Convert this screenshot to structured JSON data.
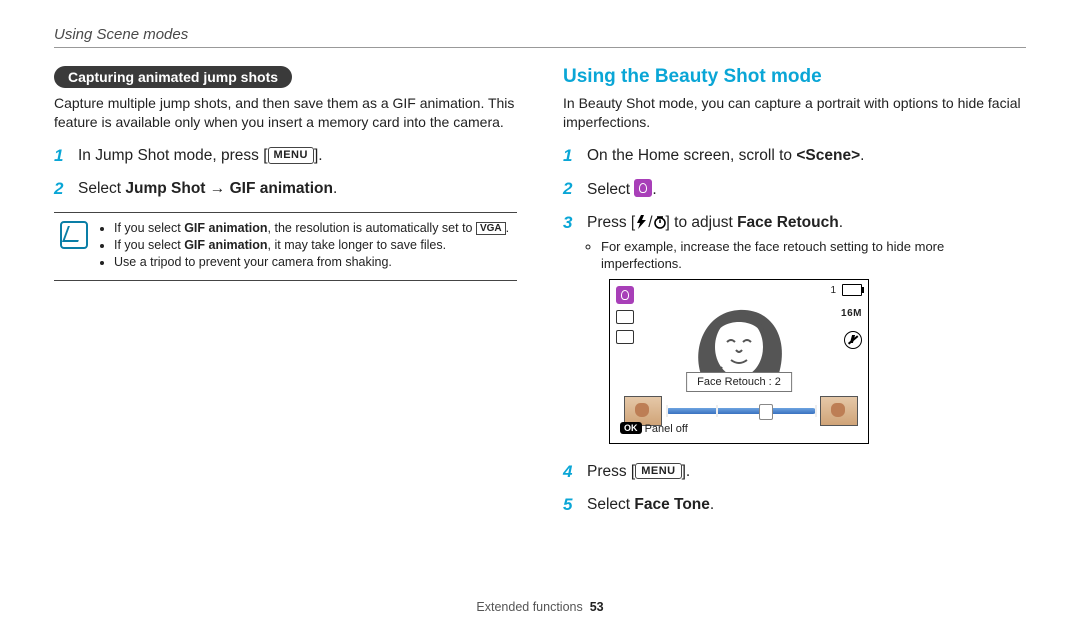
{
  "chapter": "Using Scene modes",
  "left": {
    "pill": "Capturing animated jump shots",
    "intro": "Capture multiple jump shots, and then save them as a GIF animation. This feature is available only when you insert a memory card into the camera.",
    "step1_pre": "In Jump Shot mode, press [",
    "step1_menu": "MENU",
    "step1_post": "].",
    "step2_a": "Select ",
    "step2_b": "Jump Shot",
    "step2_arrow": " → ",
    "step2_c": "GIF animation",
    "step2_d": ".",
    "note1_a": "If you select ",
    "note1_b": "GIF animation",
    "note1_c": ", the resolution is automatically set to ",
    "note1_vga": "VGA",
    "note1_d": ".",
    "note2_a": "If you select ",
    "note2_b": "GIF animation",
    "note2_c": ", it may take longer to save files.",
    "note3": "Use a tripod to prevent your camera from shaking."
  },
  "right": {
    "heading": "Using the Beauty Shot mode",
    "intro": "In Beauty Shot mode, you can capture a portrait with options to hide facial imperfections.",
    "step1_a": "On the Home screen, scroll to ",
    "step1_b": "<Scene>",
    "step1_c": ".",
    "step2": "Select ",
    "step2_post": ".",
    "step3_a": "Press [",
    "step3_sep": "/",
    "step3_b": "] to adjust ",
    "step3_c": "Face Retouch",
    "step3_d": ".",
    "step3_sub": "For example, increase the face retouch setting to hide more imperfections.",
    "step4_a": "Press [",
    "step4_menu": "MENU",
    "step4_b": "].",
    "step5_a": "Select ",
    "step5_b": "Face Tone",
    "step5_c": "."
  },
  "preview": {
    "count": "1",
    "res": "16M",
    "retouch_label": "Face Retouch : 2",
    "ok": "OK",
    "panel_off": "Panel off",
    "slider": {
      "value": 2,
      "max": 3
    }
  },
  "footer_section": "Extended functions",
  "footer_page": "53"
}
